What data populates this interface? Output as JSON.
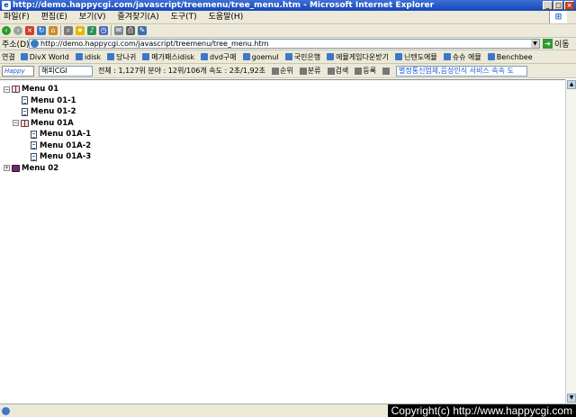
{
  "window": {
    "title": "http://demo.happycgi.com/javascript/treemenu/tree_menu.htm - Microsoft Internet Explorer"
  },
  "menubar": {
    "items": [
      "파일(F)",
      "편집(E)",
      "보기(V)",
      "즐겨찾기(A)",
      "도구(T)",
      "도움말(H)"
    ]
  },
  "address": {
    "label": "주소(D)",
    "url": "http://demo.happycgi.com/javascript/treemenu/tree_menu.htm",
    "go_label": "이동"
  },
  "links": {
    "label": "연결",
    "items": [
      "DivX World",
      "idisk",
      "당나귀",
      "메가패스idisk",
      "dvd구매",
      "goemul",
      "국민은행",
      "에뮬게임다운받기",
      "닌텐도에뮬",
      "슈슈 에뮬",
      "Benchbee"
    ]
  },
  "happybar": {
    "logo": "Happy",
    "search_value": "해피CGI",
    "stats": "전체 : 1,127위   분야 : 12위/106개   속도 : 2초/1,92초",
    "buttons": [
      "순위",
      "분류",
      "검색",
      "등록"
    ],
    "ad_text": "별정통신업체,음성인식 서비스 속속 도"
  },
  "tree": {
    "menu01": "Menu 01",
    "menu01_1": "Menu 01-1",
    "menu01_2": "Menu 01-2",
    "menu01A": "Menu 01A",
    "menu01A_1": "Menu 01A-1",
    "menu01A_2": "Menu 01A-2",
    "menu01A_3": "Menu 01A-3",
    "menu02": "Menu 02"
  },
  "status": {
    "copyright": "Copyright(c) http://www.happycgi.com"
  }
}
